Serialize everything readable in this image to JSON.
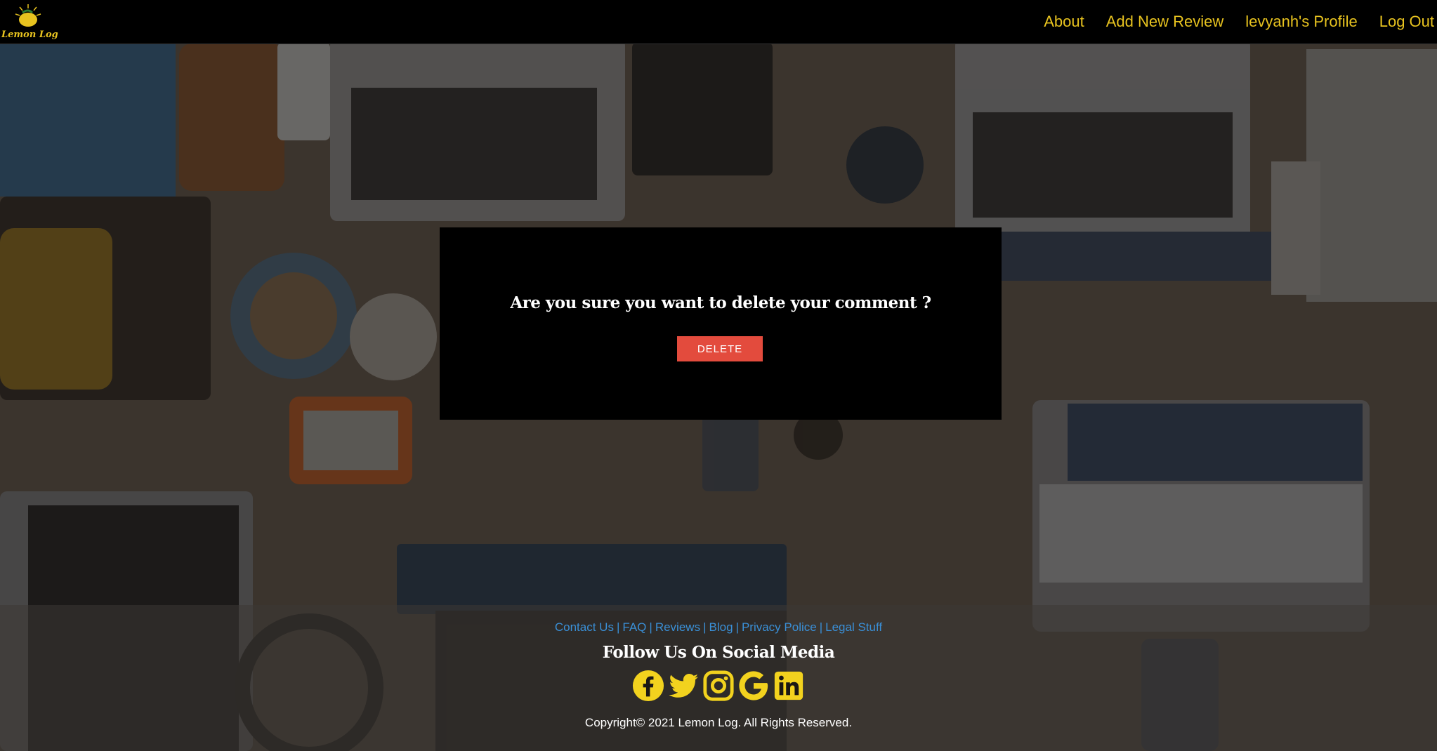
{
  "brand": {
    "name": "Lemon Log",
    "accent_color": "#e8c31f"
  },
  "nav": {
    "items": [
      {
        "label": "About"
      },
      {
        "label": "Add New Review"
      },
      {
        "label": "levyanh's Profile"
      },
      {
        "label": "Log Out"
      }
    ]
  },
  "modal": {
    "question": "Are you sure you want to delete your comment ?",
    "delete_label": "DELETE",
    "delete_color": "#e34b3d"
  },
  "footer": {
    "links": [
      {
        "label": "Contact Us"
      },
      {
        "label": "FAQ"
      },
      {
        "label": "Reviews"
      },
      {
        "label": "Blog"
      },
      {
        "label": "Privacy Police"
      },
      {
        "label": "Legal Stuff"
      }
    ],
    "link_separator": "|",
    "follow_title": "Follow Us On Social Media",
    "social": [
      {
        "icon": "facebook-icon"
      },
      {
        "icon": "twitter-icon"
      },
      {
        "icon": "instagram-icon"
      },
      {
        "icon": "google-icon"
      },
      {
        "icon": "linkedin-icon"
      }
    ],
    "copyright": "Copyright© 2021 Lemon Log. All Rights Reserved."
  }
}
